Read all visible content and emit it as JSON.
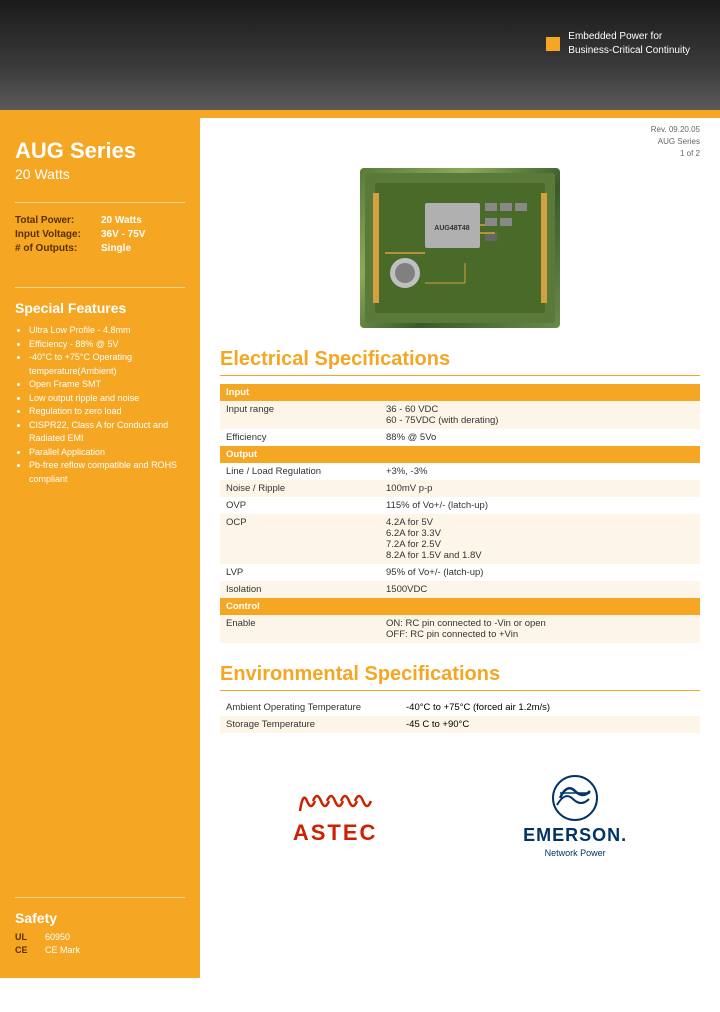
{
  "header": {
    "brand_line1": "Embedded Power for",
    "brand_line2": "Business-Critical Continuity"
  },
  "rev": {
    "line1": "Rev. 09.20.05",
    "line2": "AUG Series",
    "line3": "1 of 2"
  },
  "sidebar": {
    "title": "AUG Series",
    "subtitle": "20 Watts",
    "specs": [
      {
        "label": "Total Power:",
        "value": "20 Watts"
      },
      {
        "label": "Input Voltage:",
        "value": "36V - 75V"
      },
      {
        "label": "# of Outputs:",
        "value": "Single"
      }
    ],
    "features_title": "Special Features",
    "features": [
      "Ultra Low Profile - 4.8mm",
      "Efficiency - 88% @ 5V",
      "-40°C to +75°C Operating temperature(Ambient)",
      "Open Frame SMT",
      "Low output ripple and noise",
      "Regulation to zero load",
      "CISPR22, Class A for Conduct and Radiated EMI",
      "Parallel Application",
      "Pb-free reflow compatible and ROHS compliant"
    ],
    "safety_title": "Safety",
    "safety": [
      {
        "label": "UL",
        "value": "60950"
      },
      {
        "label": "CE",
        "value": "CE Mark"
      }
    ]
  },
  "electrical": {
    "section_title": "Electrical Specifications",
    "input_header": "Input",
    "rows_input": [
      {
        "label": "Input range",
        "value": "36 - 60 VDC\n60 - 75VDC (with derating)"
      },
      {
        "label": "Efficiency",
        "value": "88% @ 5Vo"
      }
    ],
    "output_header": "Output",
    "rows_output": [
      {
        "label": "Line / Load Regulation",
        "value": "+3%, -3%"
      },
      {
        "label": "Noise / Ripple",
        "value": "100mV p-p"
      },
      {
        "label": "OVP",
        "value": "115% of Vo+/- (latch-up)"
      },
      {
        "label": "OCP",
        "value": "4.2A for 5V\n6.2A for 3.3V\n7.2A for 2.5V\n8.2A for 1.5V and 1.8V"
      },
      {
        "label": "LVP",
        "value": "95% of Vo+/- (latch-up)"
      },
      {
        "label": "Isolation",
        "value": "1500VDC"
      }
    ],
    "control_header": "Control",
    "rows_control": [
      {
        "label": "Enable",
        "value": "ON: RC pin connected to -Vin or open\nOFF: RC pin connected to +Vin"
      }
    ]
  },
  "environmental": {
    "section_title": "Environmental Specifications",
    "rows": [
      {
        "label": "Ambient Operating Temperature",
        "value": "-40°C to +75°C (forced air 1.2m/s)"
      },
      {
        "label": "Storage Temperature",
        "value": "-45 C to +90°C"
      }
    ]
  },
  "footer": {
    "astec_text": "ASTEC",
    "emerson_text": "EMERSON.",
    "emerson_sub": "Network Power"
  }
}
